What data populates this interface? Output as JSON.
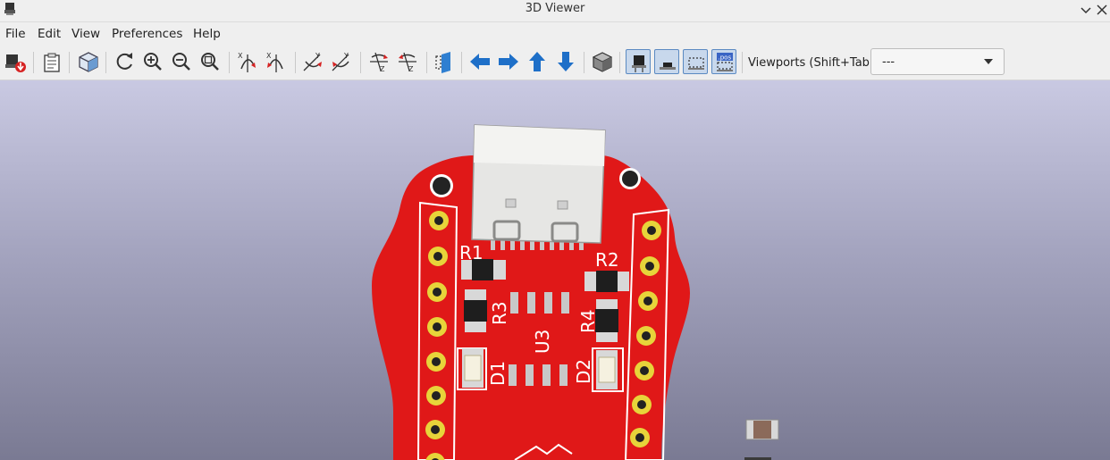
{
  "window": {
    "title": "3D Viewer"
  },
  "menu": {
    "items": [
      "File",
      "Edit",
      "View",
      "Preferences",
      "Help"
    ]
  },
  "toolbar": {
    "viewports_label": "Viewports (Shift+Tab):",
    "viewports_value": "---"
  },
  "board": {
    "designators": [
      "R1",
      "R2",
      "R3",
      "R4",
      "U3",
      "D1",
      "D2"
    ],
    "colors": {
      "soldermask": "#e01818",
      "silkscreen": "#ffffff",
      "pad": "#e7d43a",
      "background_top": "#c9c9e2",
      "background_bottom": "#7a7a93"
    }
  },
  "icons": [
    "render-export-icon",
    "copy-to-clipboard-icon",
    "board-render-icon",
    "reload-icon",
    "zoom-in-icon",
    "zoom-out-icon",
    "zoom-fit-icon",
    "rotate-x-cw-icon",
    "rotate-x-ccw-icon",
    "rotate-y-cw-icon",
    "rotate-y-ccw-icon",
    "rotate-z-cw-icon",
    "rotate-z-ccw-icon",
    "flip-board-icon",
    "move-left-icon",
    "move-right-icon",
    "move-up-icon",
    "move-down-icon",
    "orthographic-icon",
    "show-tht-icon",
    "show-smd-icon",
    "show-virtual-icon",
    "show-not-in-posfile-icon"
  ]
}
